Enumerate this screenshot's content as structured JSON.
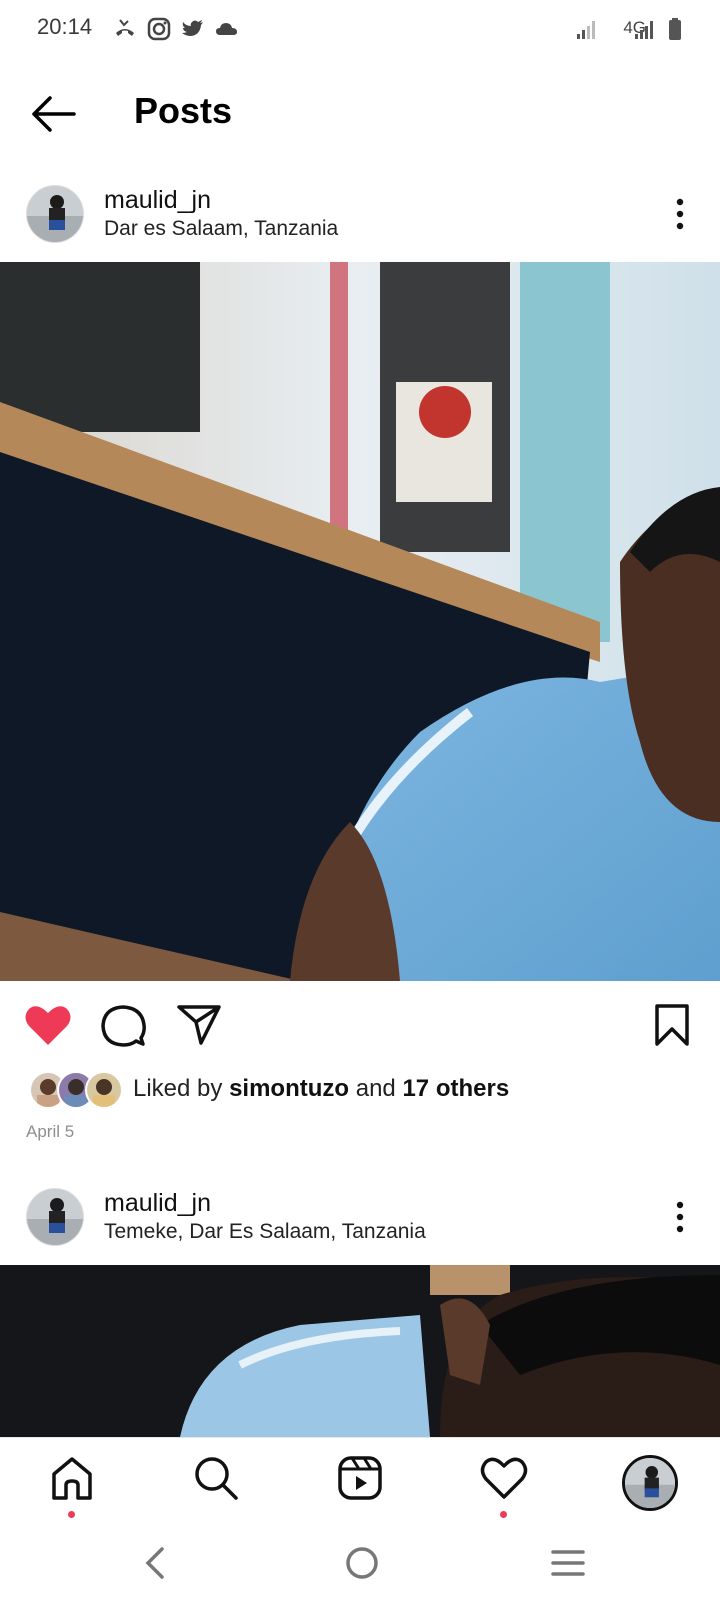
{
  "status_bar": {
    "time": "20:14",
    "network": "4G",
    "icons": [
      "missed-call-icon",
      "instagram-icon",
      "twitter-icon",
      "cloud-icon",
      "signal-icon",
      "battery-icon"
    ]
  },
  "header": {
    "title": "Posts",
    "back_icon": "back-arrow-icon"
  },
  "posts": [
    {
      "username": "maulid_jn",
      "location": "Dar es Salaam, Tanzania",
      "liked_by_prefix": "Liked by ",
      "liked_by_user": "simontuzo",
      "liked_by_mid": " and ",
      "liked_by_others": "17 others",
      "date": "April 5",
      "liked": true
    },
    {
      "username": "maulid_jn",
      "location": "Temeke, Dar Es Salaam, Tanzania"
    }
  ],
  "bottom_nav": {
    "items": [
      "home-icon",
      "search-icon",
      "reels-icon",
      "activity-heart-icon",
      "profile-avatar"
    ],
    "active": "home-icon"
  },
  "colors": {
    "accent_red": "#ef3a57",
    "text_secondary": "#8e8e8e"
  }
}
